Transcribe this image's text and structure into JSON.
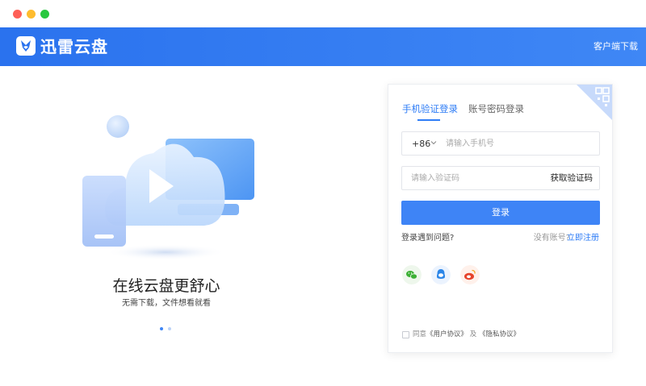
{
  "app": {
    "brand": "迅雷云盘",
    "download_link": "客户端下载"
  },
  "promo": {
    "slogan": "在线云盘更舒心",
    "subslogan": "无需下载，文件想看就看",
    "page_count": 2,
    "current_page": 1
  },
  "login": {
    "tabs": [
      {
        "label": "手机验证登录",
        "active": true
      },
      {
        "label": "账号密码登录",
        "active": false
      }
    ],
    "country_code": "+86",
    "phone_placeholder": "请输入手机号",
    "code_placeholder": "请输入验证码",
    "get_code_label": "获取验证码",
    "submit_label": "登录",
    "problem_link": "登录遇到问题?",
    "no_account_text": "没有账号?",
    "register_link": "立即注册",
    "social_logins": [
      "wechat-icon",
      "qq-icon",
      "weibo-icon"
    ],
    "agreement": {
      "prefix": "同意",
      "user_agreement": "《用户协议》",
      "conjunction": "及",
      "privacy_policy": "《隐私协议》",
      "checked": false
    }
  },
  "colors": {
    "accent": "#3e84f6",
    "header_start": "#2a72ee",
    "header_end": "#3f87f5"
  }
}
